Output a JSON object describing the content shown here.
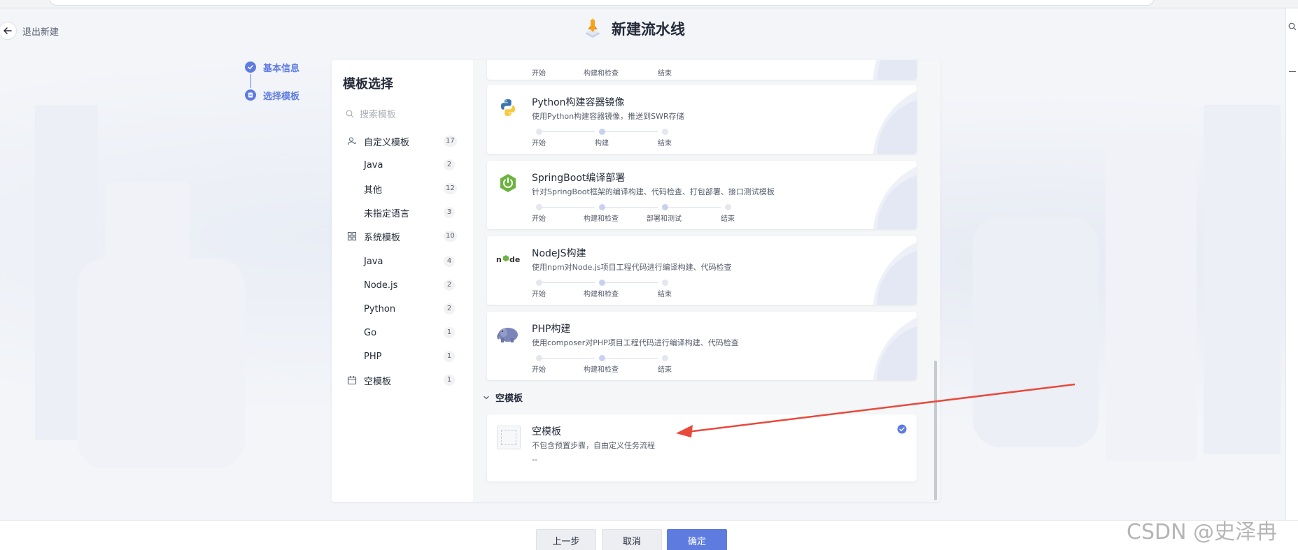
{
  "header": {
    "exit_label": "退出新建",
    "title": "新建流水线"
  },
  "steps": [
    {
      "label": "基本信息",
      "state": "done"
    },
    {
      "label": "选择模板",
      "state": "current"
    }
  ],
  "sidebar": {
    "title": "模板选择",
    "search_placeholder": "搜索模板",
    "items": [
      {
        "label": "自定义模板",
        "count": "17",
        "level": 0,
        "icon": "user-icon"
      },
      {
        "label": "Java",
        "count": "2",
        "level": 1
      },
      {
        "label": "其他",
        "count": "12",
        "level": 1
      },
      {
        "label": "未指定语言",
        "count": "3",
        "level": 1
      },
      {
        "label": "系统模板",
        "count": "10",
        "level": 0,
        "icon": "grid-icon"
      },
      {
        "label": "Java",
        "count": "4",
        "level": 1
      },
      {
        "label": "Node.js",
        "count": "2",
        "level": 1
      },
      {
        "label": "Python",
        "count": "2",
        "level": 1
      },
      {
        "label": "Go",
        "count": "1",
        "level": 1
      },
      {
        "label": "PHP",
        "count": "1",
        "level": 1
      },
      {
        "label": "空模板",
        "count": "1",
        "level": 0,
        "icon": "calendar-icon"
      }
    ]
  },
  "partial_stages": [
    "开始",
    "构建和检查",
    "结束"
  ],
  "cards": [
    {
      "icon": "python-icon",
      "title": "Python构建容器镜像",
      "desc": "使用Python构建容器镜像，推送到SWR存储",
      "stages": [
        "开始",
        "构建",
        "结束"
      ]
    },
    {
      "icon": "springboot-icon",
      "title": "SpringBoot编译部署",
      "desc": "针对SpringBoot框架的编译构建、代码检查、打包部署、接口测试模板",
      "stages": [
        "开始",
        "构建和检查",
        "部署和测试",
        "结束"
      ]
    },
    {
      "icon": "nodejs-icon",
      "title": "NodeJS构建",
      "desc": "使用npm对Node.js项目工程代码进行编译构建、代码检查",
      "stages": [
        "开始",
        "构建和检查",
        "结束"
      ]
    },
    {
      "icon": "php-icon",
      "title": "PHP构建",
      "desc": "使用composer对PHP项目工程代码进行编译构建、代码检查",
      "stages": [
        "开始",
        "构建和检查",
        "结束"
      ]
    }
  ],
  "empty_section": {
    "title": "空模板",
    "card": {
      "title": "空模板",
      "desc": "不包含预置步骤，自由定义任务流程",
      "placeholder": "--",
      "selected": true
    }
  },
  "footer": {
    "prev_label": "上一步",
    "cancel_label": "取消",
    "confirm_label": "确定"
  },
  "watermark": "CSDN @史泽冉",
  "colors": {
    "accent": "#5e7ce0",
    "annotation_arrow": "#e8493c"
  }
}
